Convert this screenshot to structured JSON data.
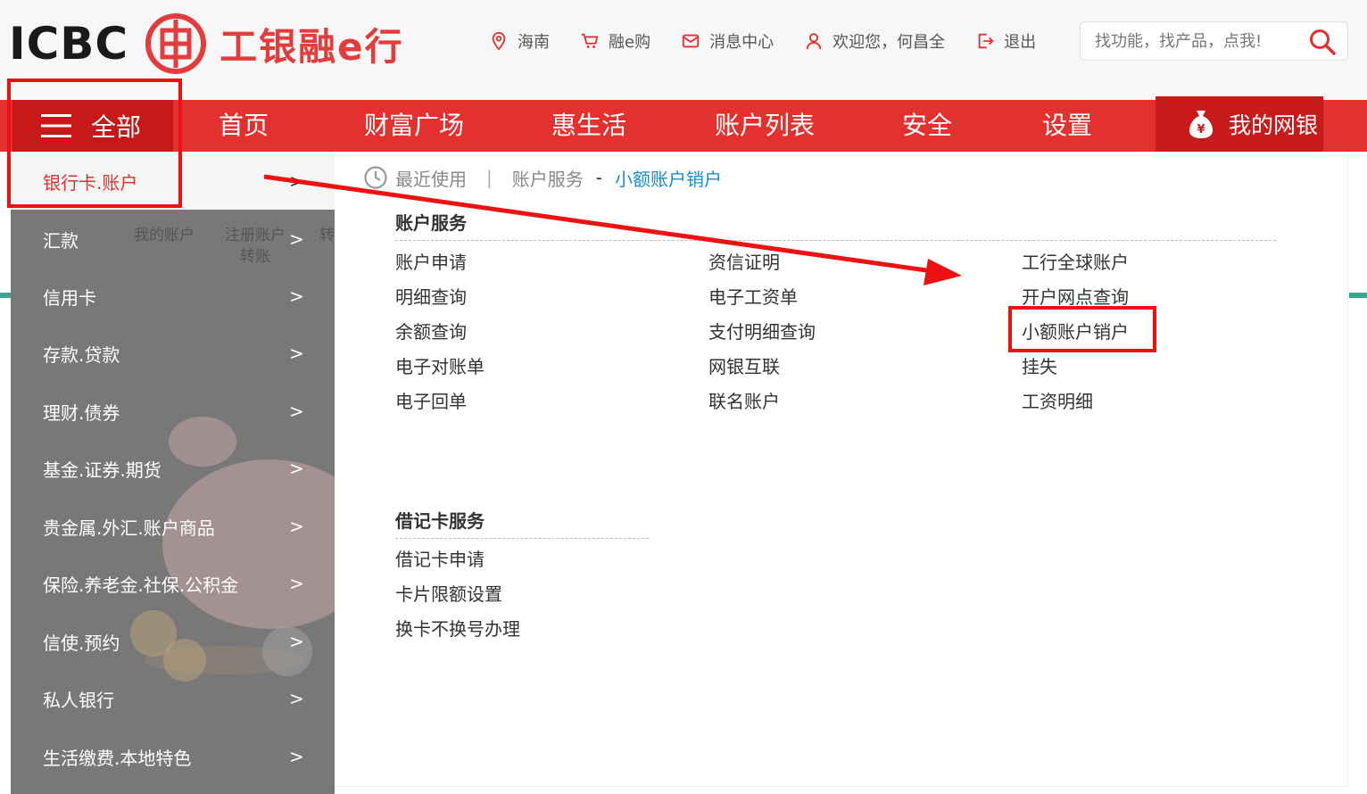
{
  "header": {
    "logo_text": "ICBC",
    "brand": "工银融e行",
    "links": [
      {
        "name": "location",
        "label": "海南"
      },
      {
        "name": "shop",
        "label": "融e购"
      },
      {
        "name": "messages",
        "label": "消息中心"
      },
      {
        "name": "user",
        "label": "欢迎您，何昌全"
      },
      {
        "name": "logout",
        "label": "退出"
      }
    ],
    "search": {
      "placeholder": "找功能，找产品，点我!"
    }
  },
  "nav": {
    "all_label": "全部",
    "items": [
      "首页",
      "财富广场",
      "惠生活",
      "账户列表",
      "安全",
      "设置"
    ],
    "mine_label": "我的网银"
  },
  "left_menu": {
    "items": [
      {
        "label": "银行卡.账户",
        "chev": ">"
      },
      {
        "label": "汇款",
        "chev": ">"
      },
      {
        "label": "信用卡",
        "chev": ">"
      },
      {
        "label": "存款.贷款",
        "chev": ">"
      },
      {
        "label": "理财.债券",
        "chev": ">"
      },
      {
        "label": "基金.证券.期货",
        "chev": ">"
      },
      {
        "label": "贵金属.外汇.账户商品",
        "chev": ">"
      },
      {
        "label": "保险.养老金.社保.公积金",
        "chev": ">"
      },
      {
        "label": "信使.预约",
        "chev": ">"
      },
      {
        "label": "私人银行",
        "chev": ">"
      },
      {
        "label": "生活缴费.本地特色",
        "chev": ">"
      }
    ]
  },
  "background_fragments": {
    "my_account": "我的账户",
    "register_line1": "注册账户",
    "register_line2": "转账",
    "transfer_fragment": "转"
  },
  "panel": {
    "recent": {
      "label": "最近使用",
      "separator": "|",
      "category": "账户服务",
      "dash": "-",
      "current": "小额账户销户"
    },
    "account_services": {
      "title": "账户服务",
      "col1": [
        "账户申请",
        "明细查询",
        "余额查询",
        "电子对账单",
        "电子回单"
      ],
      "col2": [
        "资信证明",
        "电子工资单",
        "支付明细查询",
        "网银互联",
        "联名账户"
      ],
      "col3": [
        "工行全球账户",
        "开户网点查询",
        "小额账户销户",
        "挂失",
        "工资明细"
      ]
    },
    "debit_services": {
      "title": "借记卡服务",
      "items": [
        "借记卡申请",
        "卡片限额设置",
        "换卡不换号办理"
      ]
    }
  },
  "colors": {
    "nav_red": "#e4302f",
    "nav_dark_red": "#c8191a",
    "annotation_red": "#ee1111",
    "link_blue": "#1a8ccf"
  }
}
